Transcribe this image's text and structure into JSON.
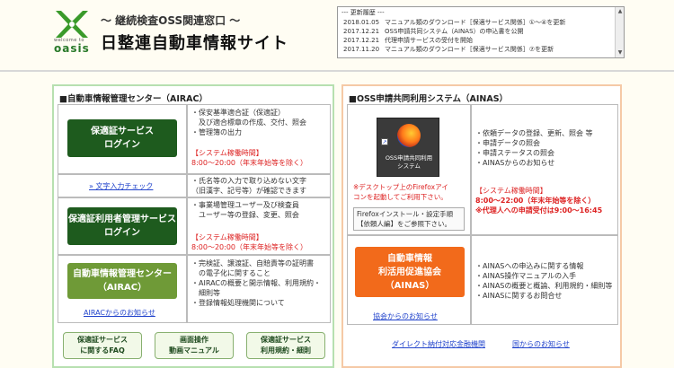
{
  "header": {
    "logo_small": "welcome to",
    "logo_name": "oasis",
    "subtitle": "～ 継続検査OSS関連窓口 ～",
    "title": "日整連自動車情報サイト"
  },
  "news": {
    "heading": "--- 更新履歴 ---",
    "items": [
      {
        "date": "2018.01.05",
        "text": "マニュアル類のダウンロード［保適サービス関係］①～④を更新"
      },
      {
        "date": "2017.12.21",
        "text": "OSS申請共同システム（AINAS）の申込書を公開"
      },
      {
        "date": "2017.12.21",
        "text": "代理申請サービスの受付を開始"
      },
      {
        "date": "2017.11.20",
        "text": "マニュアル類のダウンロード［保適サービス関係］⑦を更新"
      }
    ]
  },
  "left": {
    "title": "■自動車情報管理センター（AIRAC）",
    "hoshosho_btn": [
      "保適証サービス",
      "ログイン"
    ],
    "hoshosho_desc": [
      "・保安基準適合証（保適証）",
      "　及び適合標章の作成、交付、照会",
      "・管理簿の出力"
    ],
    "hoshosho_status_label": "【システム稼働時間】",
    "hoshosho_status_time": "8:00～20:00（年末年始等を除く）",
    "char_check_link": "» 文字入力チェック",
    "char_check_desc": [
      "・氏名等の入力で取り込めない文字",
      "（旧漢字、記号等）が確認できます"
    ],
    "user_btn": [
      "保適証利用者管理サービス",
      "ログイン"
    ],
    "user_desc": [
      "・事業場管理ユーザー及び検査員",
      "　ユーザー等の登録、変更、照会"
    ],
    "user_status_label": "【システム稼働時間】",
    "user_status_time": "8:00～20:00（年末年始等を除く）",
    "airac_btn": [
      "自動車情報管理センター",
      "（AIRAC）"
    ],
    "airac_desc": [
      "・完検証、譲渡証、自賠責等の証明書",
      "　の電子化に関すること",
      "・AIRACの概要と開示情報、利用規約・",
      "　細則等",
      "・登録情報処理機関について"
    ],
    "airac_link": "AIRACからのお知らせ",
    "bottom_buttons": [
      [
        "保適証サービス",
        "に関するFAQ"
      ],
      [
        "画面操作",
        "動画マニュアル"
      ],
      [
        "保適証サービス",
        "利用規約・細則"
      ]
    ]
  },
  "right": {
    "title": "■OSS申請共同利用システム（AINAS）",
    "app_icon_label": [
      "OSS申請共同利用",
      "システム"
    ],
    "app_desc": [
      "・依頼データの登録、更新、照会 等",
      "・申請データの照会",
      "・申請ステータスの照会",
      "・AINASからのお知らせ"
    ],
    "app_status_label": "【システム稼働時間】",
    "app_status_time": "8:00～22:00（年末年始等を除く）",
    "proxy_note": "※代理人への申請受付は9:00～16:45",
    "desktop_note": [
      "※デスクトップ上のFirefoxアイ",
      "コンを起動してご利用下さい。"
    ],
    "firefox_note": [
      "Firefoxインストール・設定手順",
      "【依頼人編】をご参照下さい。"
    ],
    "ainas_btn": [
      "自動車情報",
      "利活用促進協会",
      "（AINAS）"
    ],
    "ainas_desc": [
      "・AINASへの申込みに関する情報",
      "・AINAS操作マニュアルの入手",
      "・AINASの概要と概論、利用規約・細則等",
      "・AINASに関するお問合せ"
    ],
    "ainas_link": "協会からのお知らせ",
    "link_bank": "ダイレクト納付対応金融機関",
    "link_gov": "国からのお知らせ"
  }
}
